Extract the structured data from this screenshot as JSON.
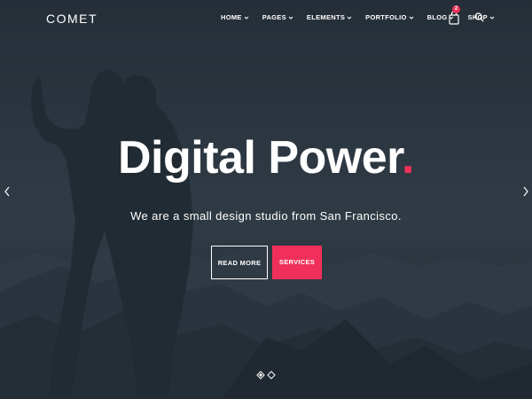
{
  "brand": {
    "name": "COMET",
    "accent": "#f0305a"
  },
  "nav": {
    "items": [
      {
        "label": "HOME"
      },
      {
        "label": "PAGES"
      },
      {
        "label": "ELEMENTS"
      },
      {
        "label": "PORTFOLIO"
      },
      {
        "label": "BLOG"
      },
      {
        "label": "SHOP"
      }
    ],
    "cart_count": "2",
    "icons": {
      "cart": "shopping-bag-icon",
      "search": "search-icon",
      "dropdown": "chevron-down-icon"
    }
  },
  "hero": {
    "headline": "Digital Power",
    "headline_dot": ".",
    "subline": "We are a small design studio from San Francisco.",
    "read_more_label": "READ MORE",
    "services_label": "SERVICES"
  },
  "slider": {
    "prev_icon": "chevron-left-icon",
    "next_icon": "chevron-right-icon",
    "slide_count": 2,
    "active_slide": 1
  }
}
